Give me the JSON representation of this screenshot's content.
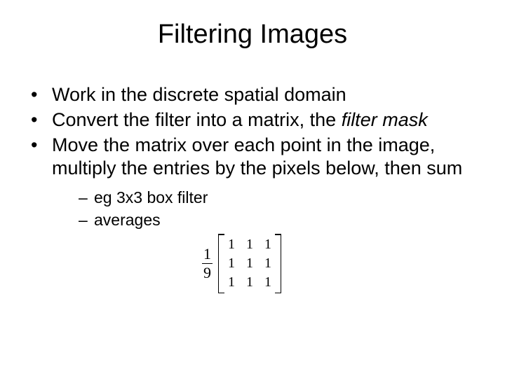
{
  "title": "Filtering Images",
  "bullets": [
    {
      "pre": "Work in the discrete spatial domain",
      "italic": "",
      "post": ""
    },
    {
      "pre": "Convert the filter into a matrix, the ",
      "italic": "filter mask",
      "post": ""
    },
    {
      "pre": "Move the matrix over each point in the image, multiply the entries by the pixels below, then sum",
      "italic": "",
      "post": ""
    }
  ],
  "sub": [
    "eg 3x3 box filter",
    "averages"
  ],
  "formula": {
    "numerator": "1",
    "denominator": "9",
    "matrix": [
      [
        "1",
        "1",
        "1"
      ],
      [
        "1",
        "1",
        "1"
      ],
      [
        "1",
        "1",
        "1"
      ]
    ]
  }
}
